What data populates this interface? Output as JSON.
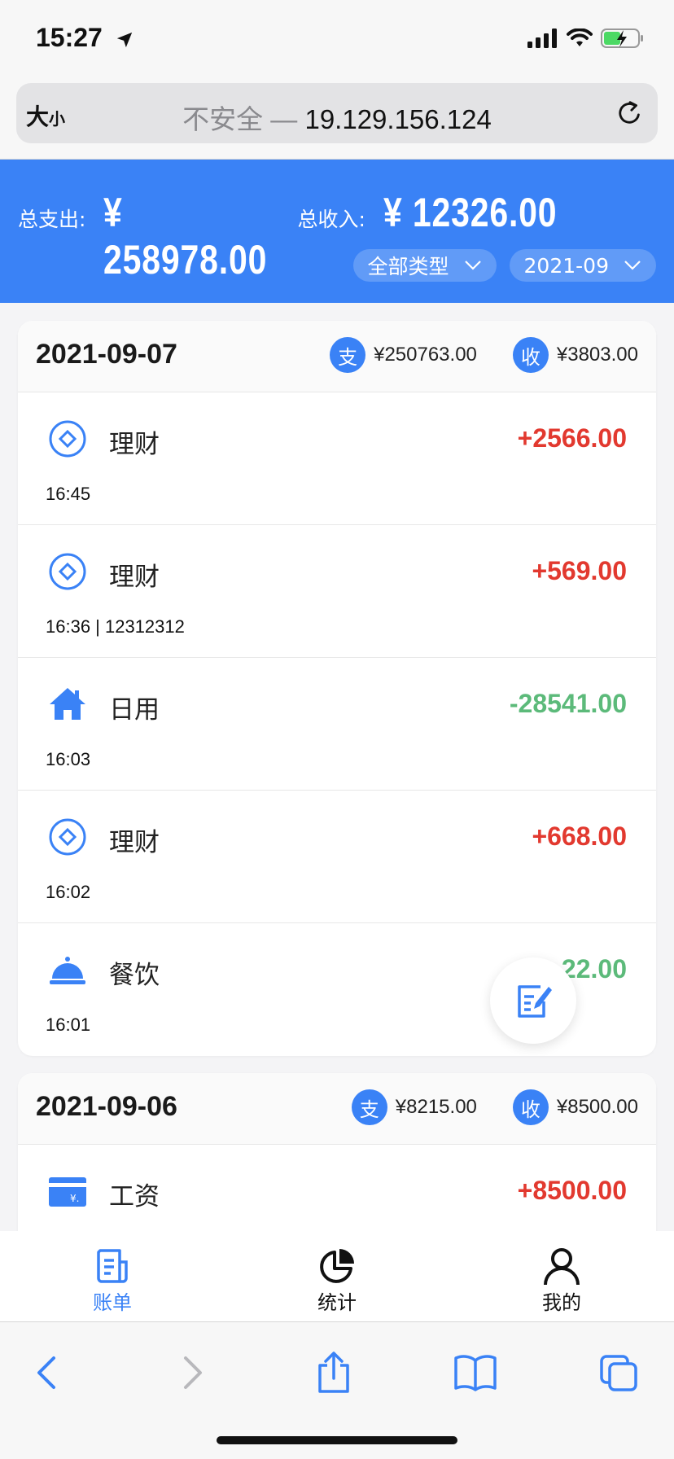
{
  "status": {
    "time": "15:27"
  },
  "browser": {
    "text_size_label_big": "大",
    "text_size_label_small": "小",
    "insecure_label": "不安全 — ",
    "host": "19.129.156.124"
  },
  "summary": {
    "expense_label": "总支出:",
    "expense_value": "¥ 258978.00",
    "income_label": "总收入:",
    "income_value": "¥ 12326.00",
    "type_filter": "全部类型",
    "month_filter": "2021-09"
  },
  "badges": {
    "expense": "支",
    "income": "收"
  },
  "days": [
    {
      "date": "2021-09-07",
      "expense_total": "¥250763.00",
      "income_total": "¥3803.00",
      "records": [
        {
          "icon": "finance-icon",
          "category": "理财",
          "amount": "+2566.00",
          "kind": "income",
          "meta": "16:45"
        },
        {
          "icon": "finance-icon",
          "category": "理财",
          "amount": "+569.00",
          "kind": "income",
          "meta": "16:36 | 12312312"
        },
        {
          "icon": "home-icon",
          "category": "日用",
          "amount": "-28541.00",
          "kind": "expense",
          "meta": "16:03"
        },
        {
          "icon": "finance-icon",
          "category": "理财",
          "amount": "+668.00",
          "kind": "income",
          "meta": "16:02"
        },
        {
          "icon": "dining-bell-icon",
          "category": "餐饮",
          "amount": "-2··22.00",
          "kind": "expense",
          "meta": "16:01"
        }
      ]
    },
    {
      "date": "2021-09-06",
      "expense_total": "¥8215.00",
      "income_total": "¥8500.00",
      "records": [
        {
          "icon": "salary-card-icon",
          "category": "工资",
          "amount": "+8500.00",
          "kind": "income",
          "meta": ""
        }
      ]
    }
  ],
  "tabs": [
    {
      "label": "账单",
      "icon": "bill-icon",
      "active": true
    },
    {
      "label": "统计",
      "icon": "pie-chart-icon",
      "active": false
    },
    {
      "label": "我的",
      "icon": "user-icon",
      "active": false
    }
  ],
  "colors": {
    "primary": "#3a82f6",
    "income": "#e2392f",
    "expense": "#5cba7a"
  }
}
